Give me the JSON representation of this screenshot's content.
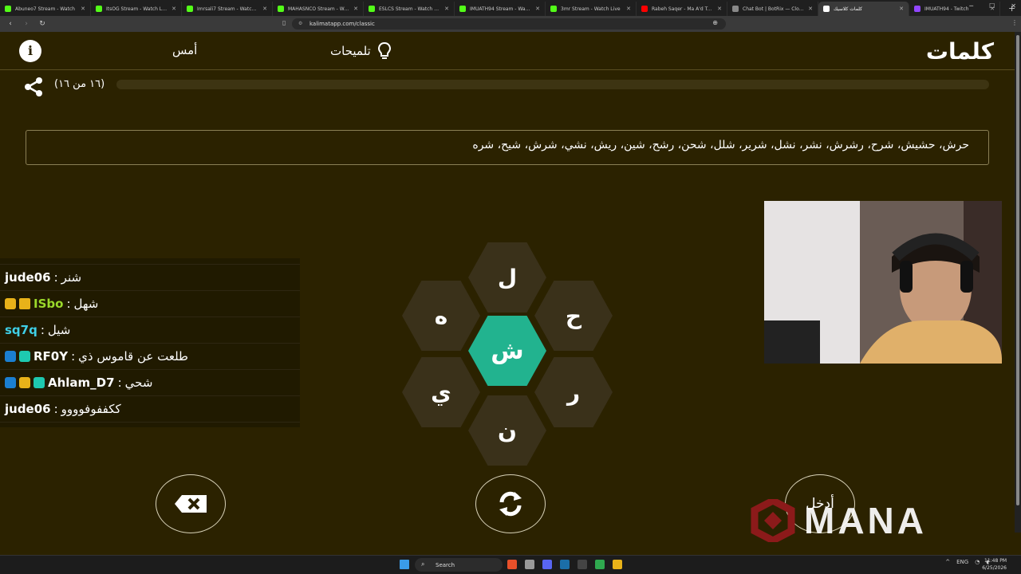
{
  "browser": {
    "tabs": [
      {
        "title": "Abuneo7 Stream - Watch",
        "color": "#53fc18"
      },
      {
        "title": "ItsOG Stream - Watch Live",
        "color": "#53fc18"
      },
      {
        "title": "Imrsali7 Stream - Watch Li...",
        "color": "#53fc18"
      },
      {
        "title": "MAHASNCO Stream - Watch",
        "color": "#53fc18"
      },
      {
        "title": "ESLCS Stream - Watch Live",
        "color": "#53fc18"
      },
      {
        "title": "IMUATH94 Stream - Watc...",
        "color": "#53fc18"
      },
      {
        "title": "3mr Stream - Watch Live",
        "color": "#53fc18"
      },
      {
        "title": "Rabeh Saqer - Ma A'd Te...",
        "color": "#ff0000"
      },
      {
        "title": "Chat Bot | BotRix — Cloud Str...",
        "color": "#888888"
      },
      {
        "title": "كلمات كلاسيك",
        "color": "#ffffff",
        "active": true
      },
      {
        "title": "IMUATH94 - Twitch",
        "color": "#9146ff"
      }
    ],
    "new_tab": "+",
    "url": "kalimatapp.com/classic"
  },
  "header": {
    "logo": "كلمات",
    "hints_label": "تلميحات",
    "yesterday_label": "أمس",
    "info_label": "i"
  },
  "progress": {
    "label": "(١٦ من ١٦)",
    "fraction": 0
  },
  "found_words": "حرش، حشيش، شرح، رشرش، نشر، نشل، شرير، شلل، شحن، رشح، شين، ريش، نشي، شرش، شيح، شره",
  "chat": {
    "partial_row": {
      "user": "...",
      "msg": "..."
    },
    "rows": [
      {
        "badges": [],
        "user": "jude06",
        "user_color": "#ffffff",
        "msg": "شنر"
      },
      {
        "badges": [
          "gold",
          "crown"
        ],
        "user": "ISbo",
        "user_color": "#9bd92b",
        "msg": "شهل"
      },
      {
        "badges": [],
        "user": "sq7q",
        "user_color": "#3fd0e8",
        "msg": "شيل"
      },
      {
        "badges": [
          "blue",
          "teal"
        ],
        "user": "RF0Y",
        "user_color": "#ffffff",
        "msg": "طلعت عن قاموس ذي"
      },
      {
        "badges": [
          "blue",
          "gold",
          "teal"
        ],
        "user": "Ahlam_D7",
        "user_color": "#ffffff",
        "msg": "شحي"
      },
      {
        "badges": [],
        "user": "jude06",
        "user_color": "#ffffff",
        "msg": "ككففوفوووو"
      }
    ]
  },
  "letters": {
    "center": "ش",
    "top": "ل",
    "top_right": "ح",
    "bottom_right": "ر",
    "bottom": "ن",
    "bottom_left": "ي",
    "top_left": "ه"
  },
  "controls": {
    "enter_label": "أدخل"
  },
  "overlay": {
    "brand": "MANA"
  },
  "taskbar": {
    "search_label": "Search",
    "lang": "ENG",
    "time": "11:48 PM",
    "date": "6/25/2026"
  },
  "colors": {
    "background": "#2b2200",
    "accent": "#22b38f",
    "hex": "#3a311a"
  },
  "icons": [
    "info-icon",
    "lightbulb-icon",
    "share-icon",
    "backspace-icon",
    "shuffle-icon",
    "mana-logo-icon",
    "windows-start-icon",
    "search-icon"
  ]
}
